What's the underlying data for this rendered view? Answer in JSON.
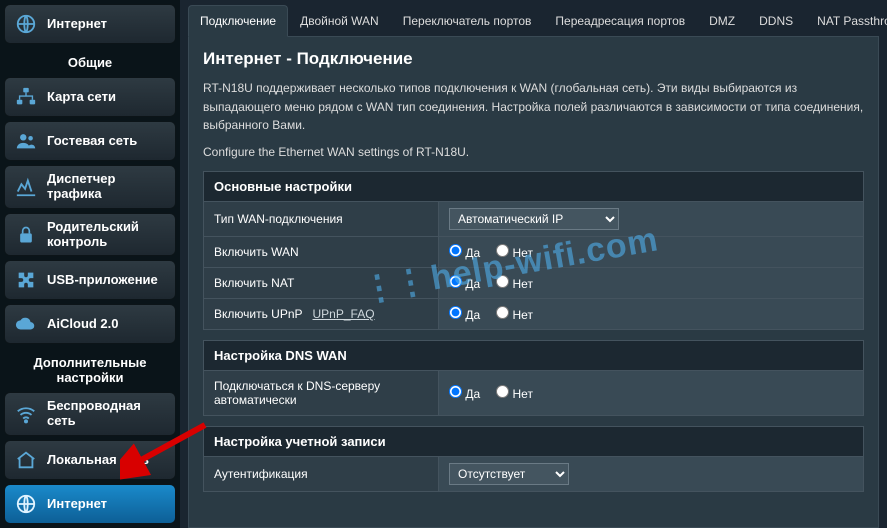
{
  "sidebar": {
    "top_item": "Интернет",
    "general_header": "Общие",
    "general": [
      {
        "label": "Карта сети"
      },
      {
        "label": "Гостевая сеть"
      },
      {
        "label": "Диспетчер трафика"
      },
      {
        "label": "Родительский контроль"
      },
      {
        "label": "USB-приложение"
      },
      {
        "label": "AiCloud 2.0"
      }
    ],
    "advanced_header": "Дополнительные настройки",
    "advanced": [
      {
        "label": "Беспроводная сеть"
      },
      {
        "label": "Локальная сеть"
      },
      {
        "label": "Интернет"
      }
    ]
  },
  "tabs": [
    "Подключение",
    "Двойной WAN",
    "Переключатель портов",
    "Переадресация портов",
    "DMZ",
    "DDNS",
    "NAT Passthrough"
  ],
  "page": {
    "title": "Интернет - Подключение",
    "desc": "RT-N18U поддерживает несколько типов подключения к WAN (глобальная сеть). Эти виды выбираются из выпадающего меню рядом с WAN тип соединения. Настройка полей различаются в зависимости от типа соединения, выбранного Вами.",
    "desc2": "Configure the Ethernet WAN settings of RT-N18U."
  },
  "sections": {
    "basic_header": "Основные настройки",
    "wan_type_label": "Тип WAN-подключения",
    "wan_type_value": "Автоматический IP",
    "enable_wan_label": "Включить WAN",
    "enable_nat_label": "Включить NAT",
    "enable_upnp_label": "Включить UPnP",
    "upnp_faq": "UPnP_FAQ",
    "dns_header": "Настройка DNS WAN",
    "dns_auto_label": "Подключаться к DNS-серверу автоматически",
    "account_header": "Настройка учетной записи",
    "auth_label": "Аутентификация",
    "auth_value": "Отсутствует",
    "yes": "Да",
    "no": "Нет"
  },
  "watermark": "help-wifi.com"
}
